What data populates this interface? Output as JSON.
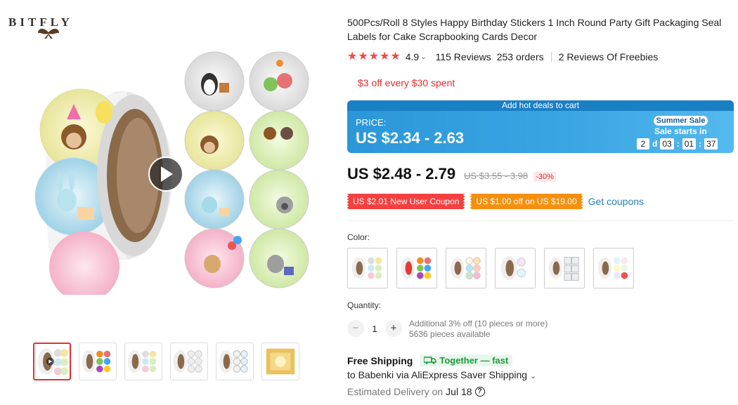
{
  "brand": {
    "logo_text": "BITFLY"
  },
  "product": {
    "title": "500Pcs/Roll 8 Styles Happy Birthday Stickers 1 Inch Round Party Gift Packaging Seal Labels for Cake Scrapbooking Cards Decor",
    "rating": "4.9",
    "rating_stars": 5,
    "reviews": "115 Reviews",
    "orders": "253 orders",
    "freebie_reviews": "2 Reviews Of Freebies"
  },
  "promo": {
    "store_discount": "$3 off every $30 spent"
  },
  "deal": {
    "top_label": "Add hot deals to cart",
    "price_label": "PRICE:",
    "price": "US $2.34 - 2.63",
    "sale_badge": "Summer Sale",
    "sale_starts": "Sale starts in",
    "countdown": {
      "days": "2",
      "days_unit": "d",
      "hours": "03",
      "minutes": "01",
      "seconds": "37"
    }
  },
  "pricing": {
    "price": "US $2.48 - 2.79",
    "original": "US $3.55 - 3.98",
    "discount": "-30%"
  },
  "coupons": {
    "new_user": "US $2.01 New User Coupon",
    "store": "US $1.00 off on US $19.00",
    "get_link": "Get coupons"
  },
  "options": {
    "color_label": "Color:",
    "variant_count": 6
  },
  "quantity": {
    "label": "Quantity:",
    "value": "1",
    "minus": "−",
    "plus": "+",
    "note_line1": "Additional 3% off (10 pieces or more)",
    "note_line2": "5636 pieces available"
  },
  "shipping": {
    "title": "Free Shipping",
    "badge": "Together — fast",
    "to": "to Babenki via AliExpress Saver Shipping",
    "delivery_label": "Estimated Delivery on",
    "delivery_date": "Jul 18",
    "help": "?"
  },
  "gallery": {
    "thumb_count": 6,
    "play_icon": "play-icon"
  },
  "colors": {
    "accent": "#e62e2e",
    "deal_blue": "#2b97d8",
    "link": "#2b7fb8",
    "green": "#1d9a3c",
    "coupon_orange": "#f5900e"
  }
}
